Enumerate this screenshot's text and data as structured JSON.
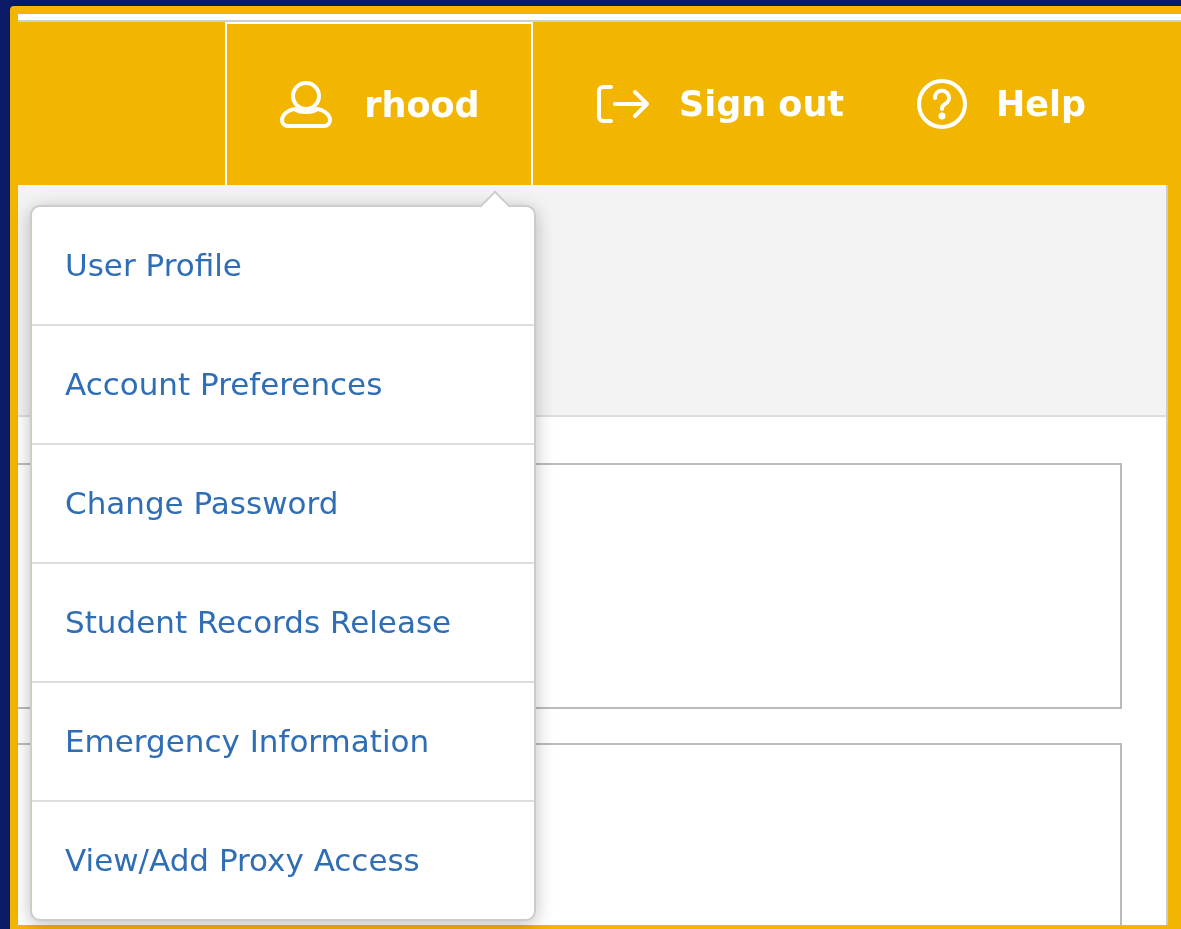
{
  "header": {
    "user": {
      "label": "rhood",
      "expanded": true
    },
    "actions": [
      {
        "kind": "signout",
        "label": "Sign out"
      },
      {
        "kind": "help",
        "label": "Help"
      }
    ]
  },
  "user_menu": {
    "items": [
      "User Profile",
      "Account Preferences",
      "Change Password",
      "Student Records Release",
      "Emergency Information",
      "View/Add Proxy Access"
    ]
  }
}
